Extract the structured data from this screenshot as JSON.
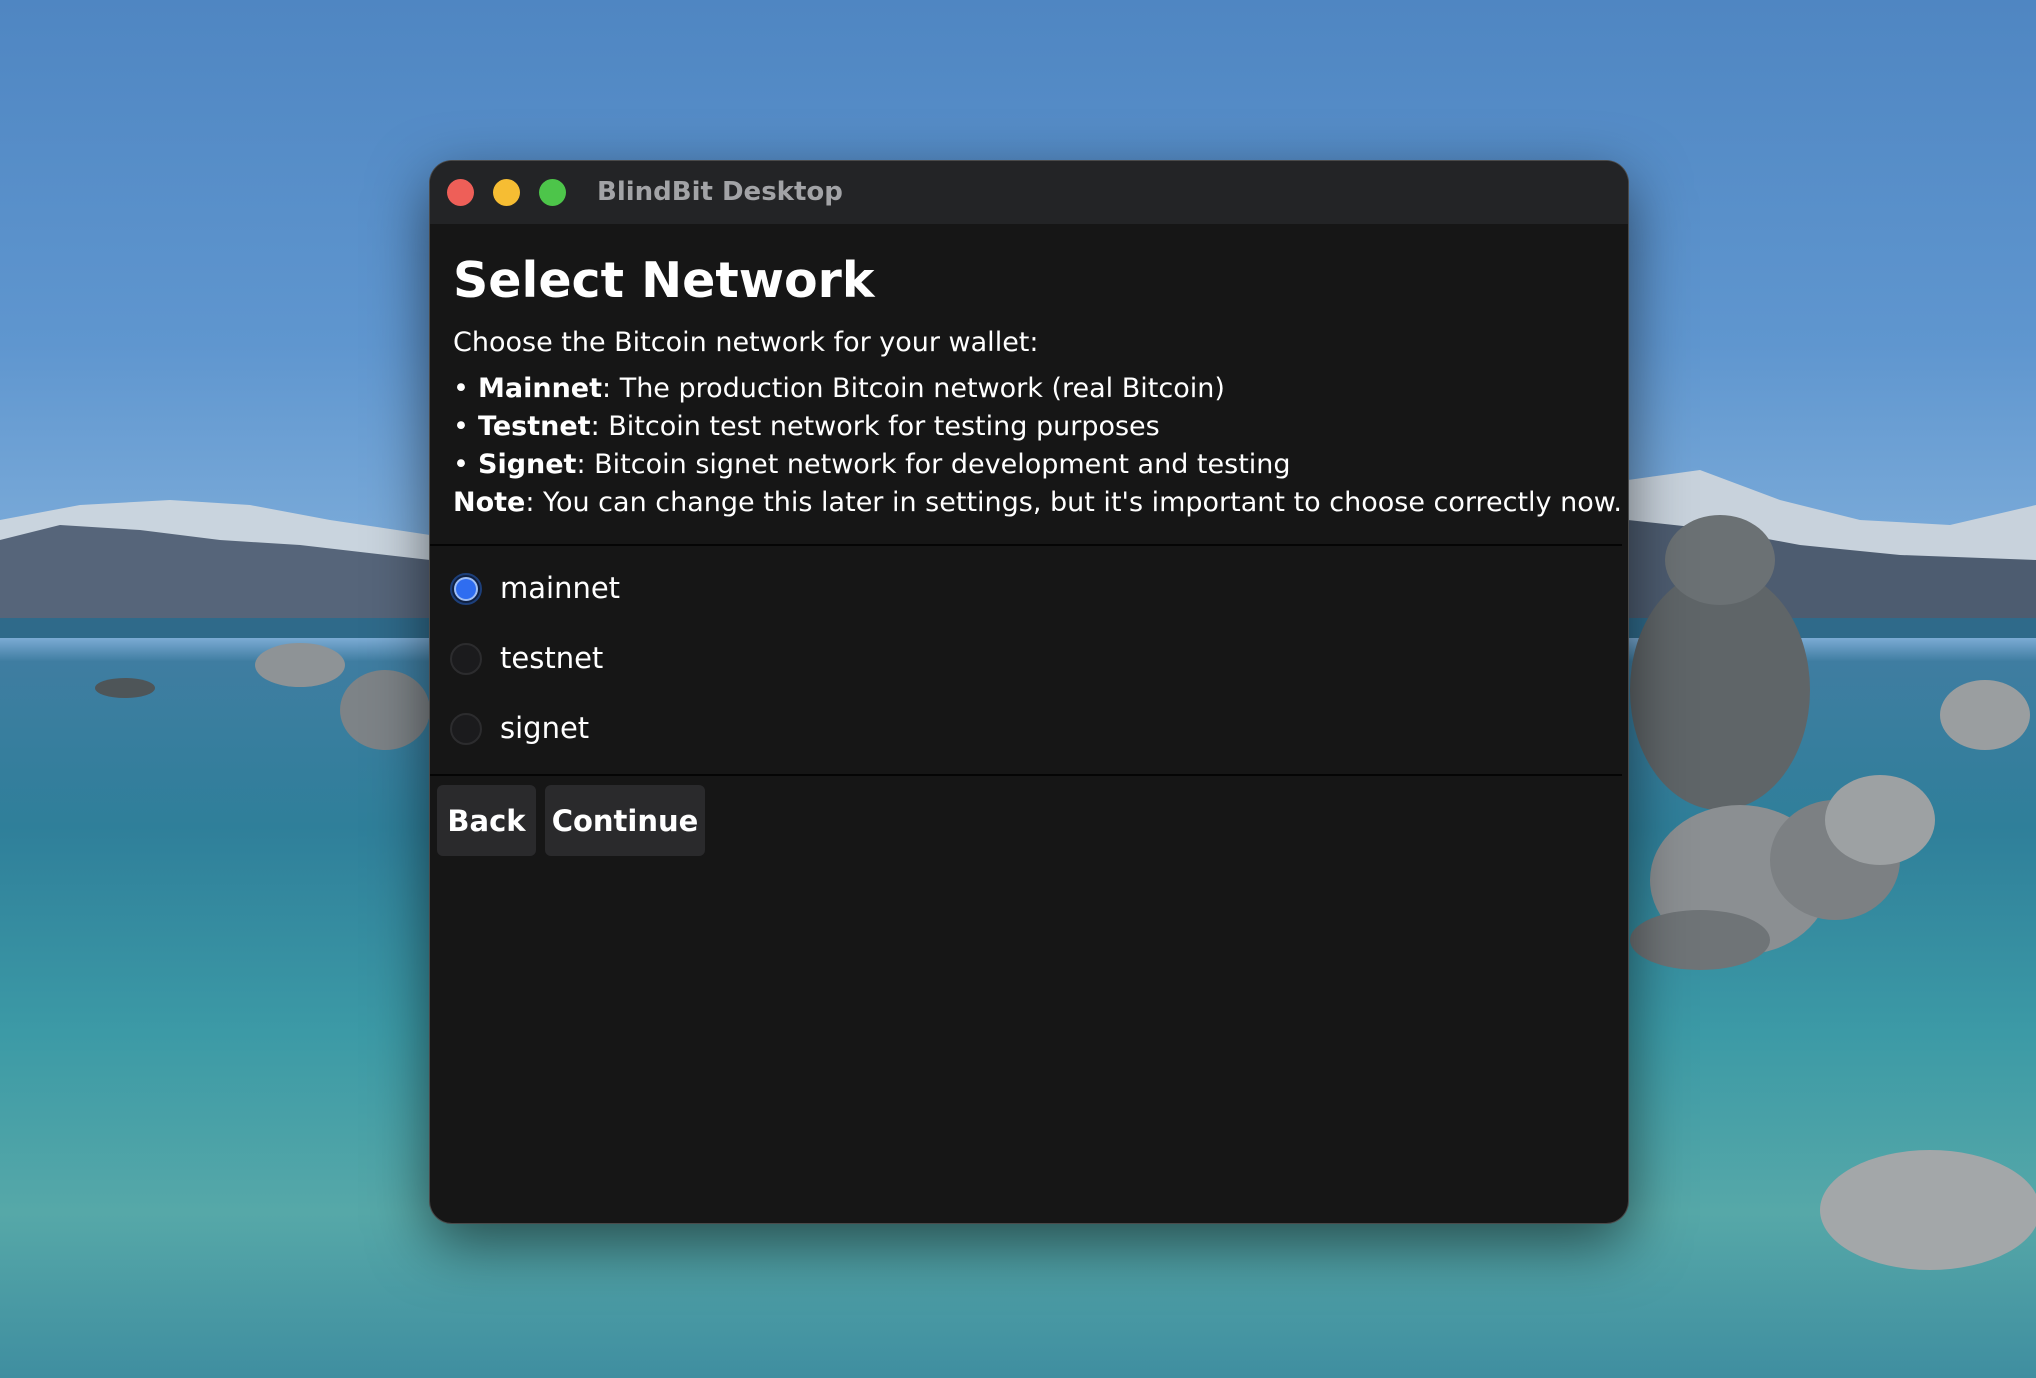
{
  "window": {
    "title": "BlindBit Desktop"
  },
  "page": {
    "title": "Select Network",
    "intro": "Choose the Bitcoin network for your wallet:",
    "bullets": [
      {
        "name": "Mainnet",
        "text": ": The production Bitcoin network (real Bitcoin)"
      },
      {
        "name": "Testnet",
        "text": ": Bitcoin test network for testing purposes"
      },
      {
        "name": "Signet",
        "text": ": Bitcoin signet network for development and testing"
      }
    ],
    "note": {
      "label": "Note",
      "text": ": You can change this later in settings, but it's important to choose correctly now."
    }
  },
  "networks": {
    "options": [
      {
        "label": "mainnet",
        "selected": true
      },
      {
        "label": "testnet",
        "selected": false
      },
      {
        "label": "signet",
        "selected": false
      }
    ]
  },
  "buttons": {
    "back": "Back",
    "continue": "Continue"
  },
  "colors": {
    "accent": "#2f6df0",
    "window_bg": "#161616",
    "titlebar_bg": "#232426",
    "button_bg": "#2a2a2c",
    "close": "#ee5f58",
    "minimize": "#f6bd33",
    "maximize": "#4dc54a"
  }
}
